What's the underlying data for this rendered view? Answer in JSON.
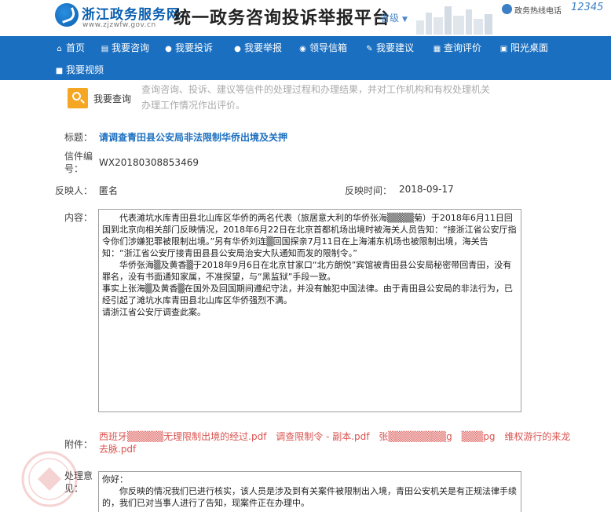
{
  "header": {
    "logo_text": "浙江政务服务网",
    "logo_url": "www.zjzwfw.gov.cn",
    "platform_title": "统一政务咨询投诉举报平台",
    "region_selector": "省级",
    "hotline_label": "政务热线电话",
    "hotline_number": "12345"
  },
  "nav": {
    "row1": [
      {
        "label": "首页",
        "icon": "home-icon"
      },
      {
        "label": "我要咨询",
        "icon": "doc-icon"
      },
      {
        "label": "我要投诉",
        "icon": "user-icon"
      },
      {
        "label": "我要举报",
        "icon": "user-icon"
      },
      {
        "label": "领导信箱",
        "icon": "message-icon"
      },
      {
        "label": "我要建议",
        "icon": "pencil-icon"
      },
      {
        "label": "查询评价",
        "icon": "list-icon"
      },
      {
        "label": "阳光桌面",
        "icon": "desktop-icon"
      }
    ],
    "row2": [
      {
        "label": "我要视频",
        "icon": "video-icon"
      }
    ]
  },
  "notice": {
    "label": "我要查询",
    "text": "查询咨询、投诉、建议等信件的处理过程和办理结果，并对工作机构和有权处理机关办理工作情况作出评价。"
  },
  "letter": {
    "title_label": "标题：",
    "title": "请调查青田县公安局非法限制华侨出境及关押",
    "number_label": "信件编号：",
    "number": "WX20180308853469",
    "reporter_label": "反映人：",
    "reporter": "匿名",
    "time_label": "反映时间：",
    "time": "2018-09-17",
    "content_label": "内容：",
    "content_paragraphs": [
      "代表滩坑水库青田县北山库区华侨的两名代表（旅居意大利的华侨张海▒▒▒▒菊）于2018年6月11日回国到北京向相关部门反映情况，2018年6月22日在北京首都机场出境时被海关人员告知：“接浙江省公安厅指令你们涉嫌犯罪被限制出境。”另有华侨刘连▒回国探亲7月11日在上海浦东机场也被限制出境，海关告知：“浙江省公安厅接青田县县公安局治安大队通知而发的限制令。”",
      "华侨张海▒及黄香▒于2018年9月6日在北京甘家口“北方朗悦”宾馆被青田县公安局秘密带回青田，没有罪名，没有书面通知家属，不准探望，与“黑监狱”手段一致。",
      "事实上张海▒及黄香▒在国外及回国期间遵纪守法，并没有触犯中国法律。由于青田县公安局的非法行为，已经引起了滩坑水库青田县北山库区华侨强烈不满。",
      "请浙江省公安厅调查此案。"
    ],
    "attachment_label": "附件：",
    "attachments": [
      "西班牙▒▒▒▒▒无理限制出境的经过.pdf",
      "调查限制令 - 副本.pdf",
      "张▒▒▒▒▒▒▒▒g",
      "▒▒▒pg",
      "维权游行的来龙去脉.pdf"
    ],
    "reply_label": "处理意见：",
    "reply_paragraphs": [
      "你好：",
      "你反映的情况我们已进行核实，该人员是涉及到有关案件被限制出入境，青田公安机关是有正规法律手续的，我们已对当事人进行了告知，现案件正在办理中。"
    ]
  },
  "colors": {
    "nav_bg": "#1b6fc0",
    "accent": "#f5a623",
    "link": "#1b6fc0",
    "attachment": "#d9534f"
  }
}
